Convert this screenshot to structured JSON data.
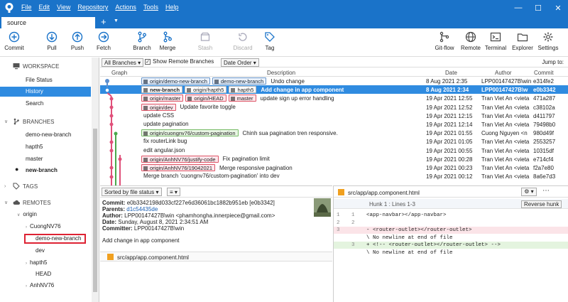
{
  "menu": [
    "File",
    "Edit",
    "View",
    "Repository",
    "Actions",
    "Tools",
    "Help"
  ],
  "tab": {
    "name": "source",
    "plus": "+"
  },
  "toolbar": {
    "left": [
      {
        "label": "Commit",
        "icon": "commit-icon"
      },
      {
        "label": "Pull",
        "icon": "pull-icon"
      },
      {
        "label": "Push",
        "icon": "push-icon"
      },
      {
        "label": "Fetch",
        "icon": "fetch-icon"
      },
      {
        "label": "Branch",
        "icon": "branch-icon"
      },
      {
        "label": "Merge",
        "icon": "merge-icon"
      },
      {
        "label": "Stash",
        "icon": "stash-icon"
      },
      {
        "label": "Discard",
        "icon": "discard-icon"
      },
      {
        "label": "Tag",
        "icon": "tag-icon"
      }
    ],
    "right": [
      {
        "label": "Git-flow",
        "icon": "gitflow-icon"
      },
      {
        "label": "Remote",
        "icon": "remote-icon"
      },
      {
        "label": "Terminal",
        "icon": "terminal-icon"
      },
      {
        "label": "Explorer",
        "icon": "explorer-icon"
      },
      {
        "label": "Settings",
        "icon": "settings-icon"
      }
    ]
  },
  "sidebar": {
    "workspace": "WORKSPACE",
    "file_status": "File Status",
    "history": "History",
    "search": "Search",
    "branches": "BRANCHES",
    "branch_items": [
      "demo-new-branch",
      "hapth5",
      "master",
      "new-branch"
    ],
    "tags": "TAGS",
    "remotes": "REMOTES",
    "origin": "origin",
    "remote_items": [
      "CuongNV76",
      "demo-new-branch",
      "dev",
      "hapth5",
      "HEAD",
      "AnhNV76"
    ]
  },
  "filter": {
    "branches": "All Branches",
    "show_remote": "Show Remote Branches",
    "order": "Date Order",
    "jump": "Jump to:"
  },
  "columns": {
    "graph": "Graph",
    "description": "Description",
    "date": "Date",
    "author": "Author",
    "commit": "Commit"
  },
  "commits": [
    {
      "tags": [
        {
          "t": "origin/demo-new-branch",
          "c": "blue"
        },
        {
          "t": "demo-new-branch",
          "c": "blue"
        }
      ],
      "msg": "Undo change",
      "date": "8 Aug 2021 2:35",
      "author": "LPP00147427B\\win",
      "commit": "e314fe2"
    },
    {
      "tags": [
        {
          "t": "new-branch",
          "c": "white",
          "b": true
        },
        {
          "t": "origin/hapth5",
          "c": "white"
        },
        {
          "t": "hapth5",
          "c": "white"
        }
      ],
      "msg": "Add change in app component",
      "date": "8 Aug 2021 2:34",
      "author": "LPP00147427B\\w",
      "commit": "e0b3342"
    },
    {
      "tags": [
        {
          "t": "origin/master",
          "c": "red"
        },
        {
          "t": "origin/HEAD",
          "c": "red"
        },
        {
          "t": "master",
          "c": "red"
        }
      ],
      "msg": "update sign up error handling",
      "date": "19 Apr 2021 12:55",
      "author": "Tran Viet An <vieta",
      "commit": "471a287"
    },
    {
      "tags": [
        {
          "t": "origin/dev",
          "c": "red"
        }
      ],
      "msg": "Update favorite toggle",
      "date": "19 Apr 2021 12:52",
      "author": "Tran Viet An <vieta",
      "commit": "c38102a"
    },
    {
      "tags": [],
      "msg": "update CSS",
      "date": "19 Apr 2021 12:15",
      "author": "Tran Viet An <vieta",
      "commit": "d411797"
    },
    {
      "tags": [],
      "msg": "update pagination",
      "date": "19 Apr 2021 12:14",
      "author": "Tran Viet An <vieta",
      "commit": "79498b0"
    },
    {
      "tags": [
        {
          "t": "origin/cuongnv76/custom-pagination",
          "c": "green"
        }
      ],
      "msg": "Chinh sua pagination tren responsive.",
      "date": "19 Apr 2021 01:55",
      "author": "Cuong Nguyen <n",
      "commit": "980d49f"
    },
    {
      "tags": [],
      "msg": "fix routerLink bug",
      "date": "19 Apr 2021 01:05",
      "author": "Tran Viet An <vieta",
      "commit": "2553257"
    },
    {
      "tags": [],
      "msg": "edit angular.json",
      "date": "19 Apr 2021 00:55",
      "author": "Tran Viet An <vieta",
      "commit": "10315df"
    },
    {
      "tags": [
        {
          "t": "origin/AnhNV76/justify-code",
          "c": "red"
        }
      ],
      "msg": "Fix pagination limit",
      "date": "19 Apr 2021 00:28",
      "author": "Tran Viet An <vieta",
      "commit": "e714cf4"
    },
    {
      "tags": [
        {
          "t": "origin/AnhNV76/19042021",
          "c": "red"
        }
      ],
      "msg": "Merge responsive pagination",
      "date": "19 Apr 2021 00:23",
      "author": "Tran Viet An <vieta",
      "commit": "f2a7e80"
    },
    {
      "tags": [],
      "msg": "Merge branch 'cuongnv76/custom-pagination' into dev",
      "date": "19 Apr 2021 00:12",
      "author": "Tran Viet An <vieta",
      "commit": "8a6e7d3"
    }
  ],
  "detail": {
    "sort": "Sorted by file status",
    "commit_label": "Commit:",
    "commit_value": "e0b3342198d033cf227e6d36061bc1882b951eb [e0b3342]",
    "parents_label": "Parents:",
    "parents_value": "d1c54435de",
    "author_label": "Author:",
    "author_value": "LPP00147427B\\win <phamhongha.innerpiece@gmail.com>",
    "date_label": "Date:",
    "date_value": "Sunday, August 8, 2021 2:34:51 AM",
    "committer_label": "Committer:",
    "committer_value": "LPP00147427B\\win",
    "message": "Add change in app component",
    "file": "src/app/app.component.html"
  },
  "diff": {
    "file": "src/app/app.component.html",
    "hunk": "Hunk 1 : Lines 1-3",
    "reverse": "Reverse hunk",
    "lines": [
      {
        "n1": "1",
        "n2": "1",
        "t": "  <app-navbar></app-navbar>",
        "k": "ctx"
      },
      {
        "n1": "2",
        "n2": "2",
        "t": "",
        "k": "ctx"
      },
      {
        "n1": "3",
        "n2": "",
        "t": "- <router-outlet></router-outlet>",
        "k": "del"
      },
      {
        "n1": "",
        "n2": "",
        "t": "\\  No newline at end of file",
        "k": "ctx"
      },
      {
        "n1": "",
        "n2": "3",
        "t": "+ <!-- <router-outlet></router-outlet> -->",
        "k": "add"
      },
      {
        "n1": "",
        "n2": "",
        "t": "\\  No newline at end of file",
        "k": "ctx"
      }
    ]
  }
}
